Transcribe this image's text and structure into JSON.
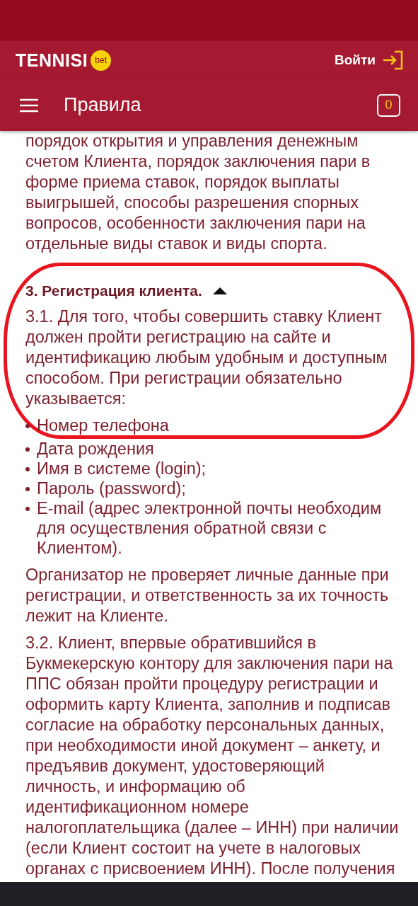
{
  "header": {
    "logo": "TENNISI",
    "logo_badge": "bet",
    "login": "Войти"
  },
  "title_bar": {
    "title": "Правила",
    "coupon_count": "0"
  },
  "content": {
    "intro": "порядок открытия и управления денежным счетом Клиента, порядок заключения пари в форме приема ставок, порядок выплаты выигрышей, способы разрешения спорных вопросов, особенности заключения пари на отдельные виды ставок и виды спорта.",
    "section": {
      "title": "3. Регистрация клиента.",
      "expanded": true
    },
    "paragraph_1": "3.1. Для того, чтобы совершить ставку Клиент должен пройти регистрацию на сайте и идентификацию любым удобным и доступным способом. При регистрации обязательно указывается:",
    "list": [
      "Номер телефона",
      "Дата рождения",
      "Имя в системе (login);",
      "Пароль (password);",
      "E-mail (адрес электронной почты необходим для осуществления обратной связи с Клиентом)."
    ],
    "paragraph_2": "Организатор не проверяет личные данные при регистрации, и ответственность за их точность лежит на Клиенте.",
    "paragraph_3": "3.2. Клиент, впервые обратившийся в Букмекерскую контору для заключения пари на ППС обязан пройти процедуру регистрации и оформить карту Клиента, заполнив и подписав согласие на обработку персональных данных, при необходимости иной документ – анкету, и предъявив документ, удостоверяющий личность, и информацию об идентификационном номере налогоплательщика (далее – ИНН) при наличии (если Клиент состоит на учете в налоговых органах с присвоением ИНН). После получения"
  }
}
